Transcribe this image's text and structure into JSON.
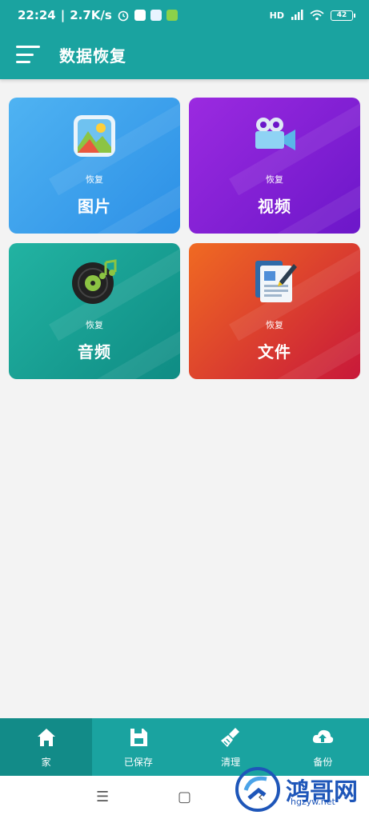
{
  "status_bar": {
    "time": "22:24",
    "speed": "2.7K/s",
    "network": "HD",
    "battery": "42"
  },
  "app_bar": {
    "title": "数据恢复"
  },
  "cards": [
    {
      "small": "恢复",
      "label": "图片",
      "icon": "photo-icon"
    },
    {
      "small": "恢复",
      "label": "视频",
      "icon": "video-camera-icon"
    },
    {
      "small": "恢复",
      "label": "音频",
      "icon": "music-disc-icon"
    },
    {
      "small": "恢复",
      "label": "文件",
      "icon": "document-edit-icon"
    }
  ],
  "bottom_nav": [
    {
      "label": "家",
      "icon": "home-icon",
      "active": true
    },
    {
      "label": "已保存",
      "icon": "save-icon",
      "active": false
    },
    {
      "label": "清理",
      "icon": "broom-icon",
      "active": false
    },
    {
      "label": "备份",
      "icon": "cloud-upload-icon",
      "active": false
    }
  ],
  "watermark": {
    "text": "鸿哥网",
    "url": "hgzyw.net"
  },
  "colors": {
    "primary": "#1aa3a0",
    "primary_dark": "#128b88",
    "background": "#f3f3f3"
  }
}
